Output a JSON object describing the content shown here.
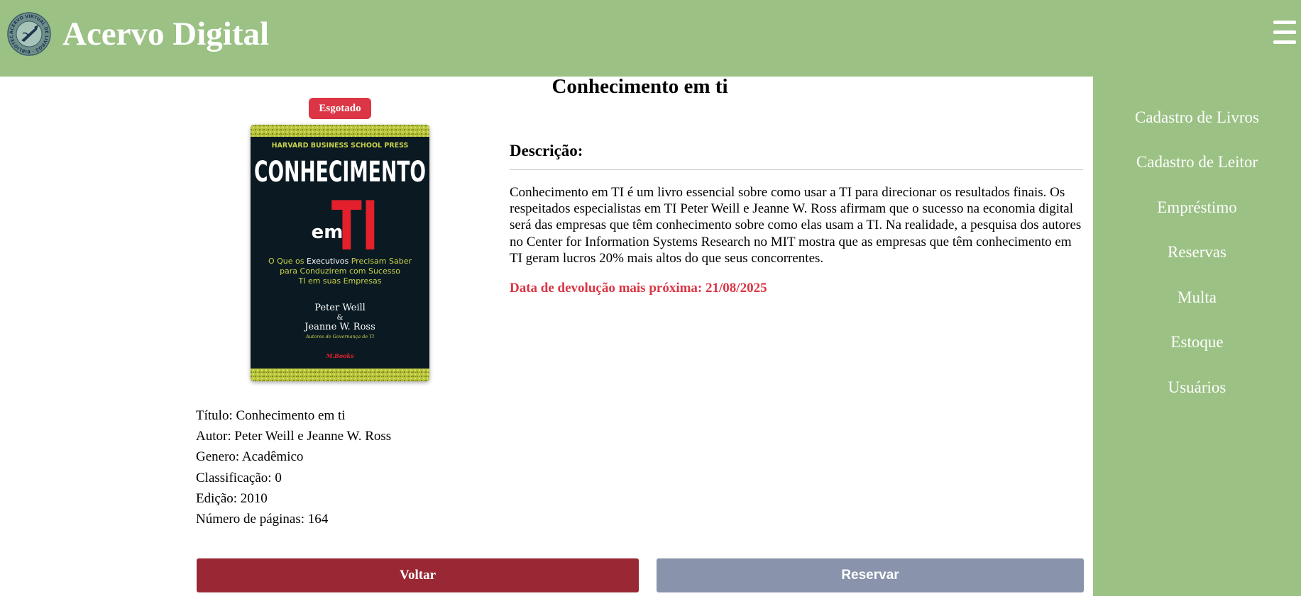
{
  "app": {
    "title": "Acervo Digital",
    "logo_ring_text": "ACERVO VIRTUAL DE LIVROS · BIBLIOTECA SC ·"
  },
  "sidebar": {
    "items": [
      {
        "label": "Cadastro de Livros"
      },
      {
        "label": "Cadastro de Leitor"
      },
      {
        "label": "Empréstimo"
      },
      {
        "label": "Reservas"
      },
      {
        "label": "Multa"
      },
      {
        "label": "Estoque"
      },
      {
        "label": "Usuários"
      }
    ]
  },
  "book": {
    "title": "Conhecimento em ti",
    "status_badge": "Esgotado",
    "cover": {
      "publisher": "HARVARD BUSINESS SCHOOL PRESS",
      "title_line1": "CONHECIMENTO",
      "title_small": "em",
      "title_big": "TI",
      "subtitle_line1_a": "O Que os",
      "subtitle_line1_b": "Executivos",
      "subtitle_line1_c": "Precisam Saber",
      "subtitle_line2": "para Conduzirem com Sucesso",
      "subtitle_line3": "TI em suas Empresas",
      "author1": "Peter Weill",
      "amp": "&",
      "author2": "Jeanne W. Ross",
      "author_note": "Autores de Governança de TI",
      "imprint": "M.Books"
    },
    "info": [
      "Título: Conhecimento em ti",
      "Autor: Peter Weill e Jeanne W. Ross",
      "Genero: Acadêmico",
      "Classificação: 0",
      "Edição: 2010",
      "Número de páginas: 164"
    ],
    "description_heading": "Descrição:",
    "description": "Conhecimento em TI é um livro essencial sobre como usar a TI para direcionar os resultados finais. Os respeitados especialistas em TI Peter Weill e Jeanne W. Ross afirmam que o sucesso na economia digital será das empresas que têm conhecimento sobre como elas usam a TI. Na realidade, a pesquisa dos autores no Center for Information Systems Research no MIT mostra que as empresas que têm conhecimento em TI geram lucros 20% mais altos do que seus concorrentes.",
    "next_return": "Data de devolução mais próxima: 21/08/2025"
  },
  "actions": {
    "back_label": "Voltar",
    "reserve_label": "Reservar"
  },
  "colors": {
    "brand_green": "#9bc184",
    "badge_red": "#dc3545",
    "back_button": "#992834",
    "reserve_button": "#8993ab"
  }
}
